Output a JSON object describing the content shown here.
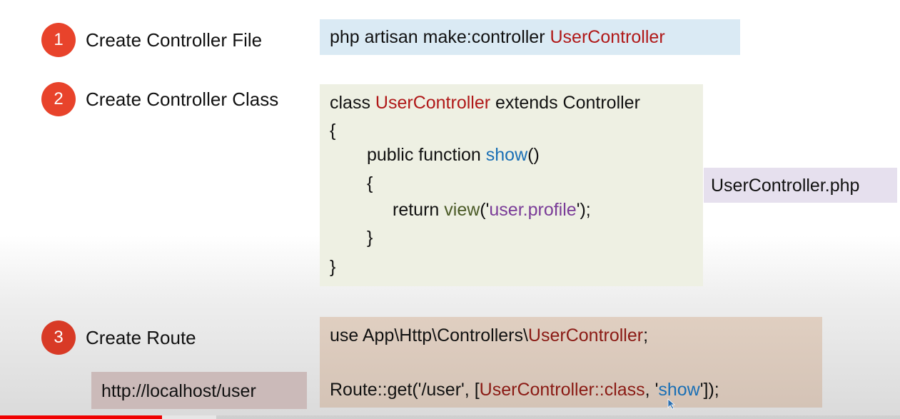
{
  "steps": [
    {
      "number": "1",
      "label": "Create Controller File"
    },
    {
      "number": "2",
      "label": "Create Controller Class"
    },
    {
      "number": "3",
      "label": "Create Route"
    }
  ],
  "command": {
    "prefix": "php artisan make:controller ",
    "name": "UserController"
  },
  "class_code": {
    "l1_a": "class ",
    "l1_b": "UserController",
    "l1_c": " extends Controller",
    "l2": "{",
    "l3_a": "public function ",
    "l3_b": "show",
    "l3_c": "()",
    "l4": "{",
    "l5_a": "return ",
    "l5_b": "view",
    "l5_c": "('",
    "l5_d": "user.profile",
    "l5_e": "');",
    "l6": "}",
    "l7": "}"
  },
  "filename": "UserController.php",
  "route_code": {
    "l1_a": "use App\\Http\\Controllers\\",
    "l1_b": "UserController",
    "l1_c": ";",
    "l2_a": "Route::get('/user', [",
    "l2_b": "UserController::class",
    "l2_c": ", '",
    "l2_d": "show",
    "l2_e": "']);"
  },
  "url": "http://localhost/user",
  "video_progress": {
    "played_fraction": 0.18,
    "buffered_fraction": 0.24
  },
  "colors": {
    "step_badge": "#e8432b",
    "keyword_red": "#b01818",
    "method_blue": "#1a6fb5",
    "string_purple": "#7a3c98",
    "progress_red": "#f00000"
  }
}
